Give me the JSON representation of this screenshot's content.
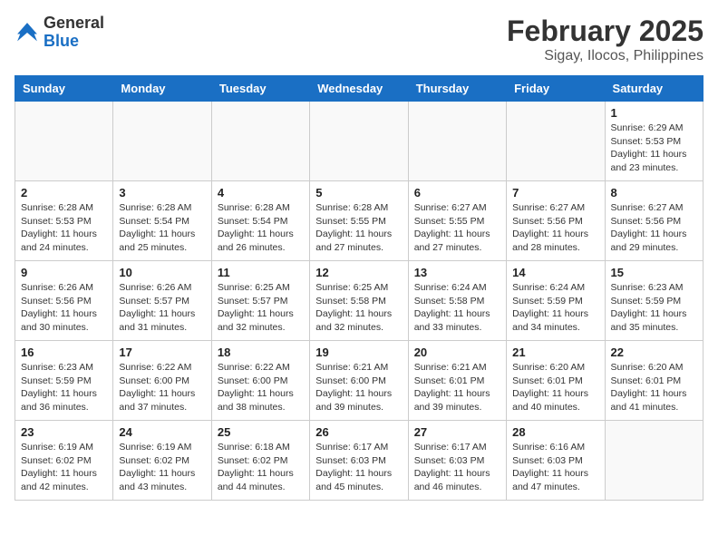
{
  "header": {
    "logo_general": "General",
    "logo_blue": "Blue",
    "month_title": "February 2025",
    "subtitle": "Sigay, Ilocos, Philippines"
  },
  "weekdays": [
    "Sunday",
    "Monday",
    "Tuesday",
    "Wednesday",
    "Thursday",
    "Friday",
    "Saturday"
  ],
  "weeks": [
    [
      {
        "day": "",
        "info": ""
      },
      {
        "day": "",
        "info": ""
      },
      {
        "day": "",
        "info": ""
      },
      {
        "day": "",
        "info": ""
      },
      {
        "day": "",
        "info": ""
      },
      {
        "day": "",
        "info": ""
      },
      {
        "day": "1",
        "info": "Sunrise: 6:29 AM\nSunset: 5:53 PM\nDaylight: 11 hours and 23 minutes."
      }
    ],
    [
      {
        "day": "2",
        "info": "Sunrise: 6:28 AM\nSunset: 5:53 PM\nDaylight: 11 hours and 24 minutes."
      },
      {
        "day": "3",
        "info": "Sunrise: 6:28 AM\nSunset: 5:54 PM\nDaylight: 11 hours and 25 minutes."
      },
      {
        "day": "4",
        "info": "Sunrise: 6:28 AM\nSunset: 5:54 PM\nDaylight: 11 hours and 26 minutes."
      },
      {
        "day": "5",
        "info": "Sunrise: 6:28 AM\nSunset: 5:55 PM\nDaylight: 11 hours and 27 minutes."
      },
      {
        "day": "6",
        "info": "Sunrise: 6:27 AM\nSunset: 5:55 PM\nDaylight: 11 hours and 27 minutes."
      },
      {
        "day": "7",
        "info": "Sunrise: 6:27 AM\nSunset: 5:56 PM\nDaylight: 11 hours and 28 minutes."
      },
      {
        "day": "8",
        "info": "Sunrise: 6:27 AM\nSunset: 5:56 PM\nDaylight: 11 hours and 29 minutes."
      }
    ],
    [
      {
        "day": "9",
        "info": "Sunrise: 6:26 AM\nSunset: 5:56 PM\nDaylight: 11 hours and 30 minutes."
      },
      {
        "day": "10",
        "info": "Sunrise: 6:26 AM\nSunset: 5:57 PM\nDaylight: 11 hours and 31 minutes."
      },
      {
        "day": "11",
        "info": "Sunrise: 6:25 AM\nSunset: 5:57 PM\nDaylight: 11 hours and 32 minutes."
      },
      {
        "day": "12",
        "info": "Sunrise: 6:25 AM\nSunset: 5:58 PM\nDaylight: 11 hours and 32 minutes."
      },
      {
        "day": "13",
        "info": "Sunrise: 6:24 AM\nSunset: 5:58 PM\nDaylight: 11 hours and 33 minutes."
      },
      {
        "day": "14",
        "info": "Sunrise: 6:24 AM\nSunset: 5:59 PM\nDaylight: 11 hours and 34 minutes."
      },
      {
        "day": "15",
        "info": "Sunrise: 6:23 AM\nSunset: 5:59 PM\nDaylight: 11 hours and 35 minutes."
      }
    ],
    [
      {
        "day": "16",
        "info": "Sunrise: 6:23 AM\nSunset: 5:59 PM\nDaylight: 11 hours and 36 minutes."
      },
      {
        "day": "17",
        "info": "Sunrise: 6:22 AM\nSunset: 6:00 PM\nDaylight: 11 hours and 37 minutes."
      },
      {
        "day": "18",
        "info": "Sunrise: 6:22 AM\nSunset: 6:00 PM\nDaylight: 11 hours and 38 minutes."
      },
      {
        "day": "19",
        "info": "Sunrise: 6:21 AM\nSunset: 6:00 PM\nDaylight: 11 hours and 39 minutes."
      },
      {
        "day": "20",
        "info": "Sunrise: 6:21 AM\nSunset: 6:01 PM\nDaylight: 11 hours and 39 minutes."
      },
      {
        "day": "21",
        "info": "Sunrise: 6:20 AM\nSunset: 6:01 PM\nDaylight: 11 hours and 40 minutes."
      },
      {
        "day": "22",
        "info": "Sunrise: 6:20 AM\nSunset: 6:01 PM\nDaylight: 11 hours and 41 minutes."
      }
    ],
    [
      {
        "day": "23",
        "info": "Sunrise: 6:19 AM\nSunset: 6:02 PM\nDaylight: 11 hours and 42 minutes."
      },
      {
        "day": "24",
        "info": "Sunrise: 6:19 AM\nSunset: 6:02 PM\nDaylight: 11 hours and 43 minutes."
      },
      {
        "day": "25",
        "info": "Sunrise: 6:18 AM\nSunset: 6:02 PM\nDaylight: 11 hours and 44 minutes."
      },
      {
        "day": "26",
        "info": "Sunrise: 6:17 AM\nSunset: 6:03 PM\nDaylight: 11 hours and 45 minutes."
      },
      {
        "day": "27",
        "info": "Sunrise: 6:17 AM\nSunset: 6:03 PM\nDaylight: 11 hours and 46 minutes."
      },
      {
        "day": "28",
        "info": "Sunrise: 6:16 AM\nSunset: 6:03 PM\nDaylight: 11 hours and 47 minutes."
      },
      {
        "day": "",
        "info": ""
      }
    ]
  ]
}
